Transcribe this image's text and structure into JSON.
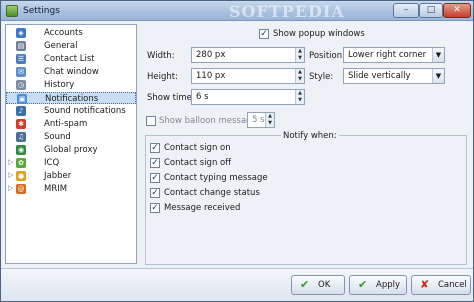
{
  "window": {
    "title": "Settings",
    "watermark": "SOFTPEDIA",
    "minimize": "–",
    "maximize": "□",
    "close": "✕"
  },
  "sidebar": {
    "items": [
      {
        "label": "Accounts",
        "icon": "accounts-icon",
        "glyph": "◈",
        "color": "#3a78c7",
        "arrow": ""
      },
      {
        "label": "General",
        "icon": "general-icon",
        "glyph": "▤",
        "color": "#6f7f96",
        "arrow": ""
      },
      {
        "label": "Contact List",
        "icon": "contact-list-icon",
        "glyph": "☰",
        "color": "#4a7bbd",
        "arrow": ""
      },
      {
        "label": "Chat window",
        "icon": "chat-window-icon",
        "glyph": "✉",
        "color": "#5c8fcc",
        "arrow": ""
      },
      {
        "label": "History",
        "icon": "history-icon",
        "glyph": "◷",
        "color": "#7c8da3",
        "arrow": ""
      },
      {
        "label": "Notifications",
        "icon": "notifications-icon",
        "glyph": "▣",
        "color": "#4f8fd8",
        "arrow": ""
      },
      {
        "label": "Sound notifications",
        "icon": "sound-notifications-icon",
        "glyph": "♪",
        "color": "#3c6fae",
        "arrow": ""
      },
      {
        "label": "Anti-spam",
        "icon": "anti-spam-icon",
        "glyph": "✱",
        "color": "#d23b2a",
        "arrow": ""
      },
      {
        "label": "Sound",
        "icon": "sound-icon",
        "glyph": "♫",
        "color": "#4c6f99",
        "arrow": ""
      },
      {
        "label": "Global proxy",
        "icon": "global-proxy-icon",
        "glyph": "◉",
        "color": "#2e8a45",
        "arrow": ""
      },
      {
        "label": "ICQ",
        "icon": "icq-icon",
        "glyph": "✿",
        "color": "#5aa83a",
        "arrow": "▷"
      },
      {
        "label": "Jabber",
        "icon": "jabber-icon",
        "glyph": "●",
        "color": "#e0a21c",
        "arrow": "▷"
      },
      {
        "label": "MRIM",
        "icon": "mrim-icon",
        "glyph": "@",
        "color": "#d66b1a",
        "arrow": "▷"
      }
    ]
  },
  "popup": {
    "show_label": "Show popup windows",
    "width_label": "Width:",
    "width_value": "280 px",
    "height_label": "Height:",
    "height_value": "110 px",
    "position_label": "Position:",
    "position_value": "Lower right corner",
    "style_label": "Style:",
    "style_value": "Slide vertically",
    "time_label": "Show time:",
    "time_value": "6 s"
  },
  "balloon": {
    "label": "Show balloon messages:",
    "value": "5 s"
  },
  "notify": {
    "title": "Notify when:",
    "items": [
      {
        "label": "Contact sign on",
        "checked": "✓"
      },
      {
        "label": "Contact sign off",
        "checked": "✓"
      },
      {
        "label": "Contact typing message",
        "checked": "✓"
      },
      {
        "label": "Contact change status",
        "checked": "✓"
      },
      {
        "label": "Message received",
        "checked": "✓"
      }
    ]
  },
  "buttons": {
    "ok": "OK",
    "ok_icon": "✔",
    "apply": "Apply",
    "apply_icon": "✔",
    "cancel": "Cancel",
    "cancel_icon": "✘"
  },
  "colors": {
    "titlebar": "#a9c1df",
    "selection": "#c9def5",
    "ok_check": "#2f9a2f",
    "cancel_x": "#c8301c"
  }
}
